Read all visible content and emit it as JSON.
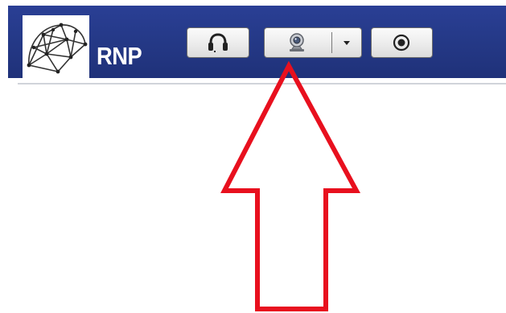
{
  "toolbar": {
    "brand_text": "RNP",
    "background_color": "#243885",
    "buttons": [
      {
        "name": "audio",
        "icon": "headset-icon"
      },
      {
        "name": "video",
        "icon": "webcam-icon",
        "has_dropdown": true,
        "dropdown_icon": "caret-down-icon"
      },
      {
        "name": "record",
        "icon": "record-icon"
      }
    ]
  },
  "annotation": {
    "type": "arrow",
    "direction": "up",
    "color": "#e8101e",
    "target": "video-button"
  }
}
